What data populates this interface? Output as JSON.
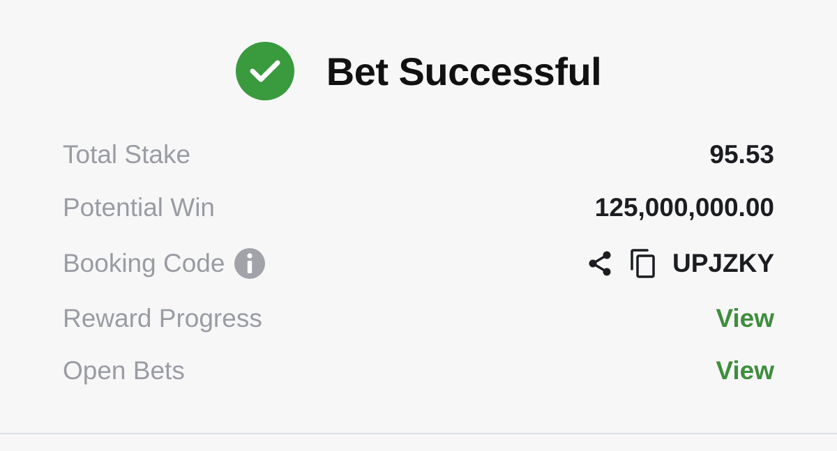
{
  "header": {
    "title": "Bet Successful",
    "status_color": "#3a9a3e",
    "icon": "check-circle-icon"
  },
  "rows": {
    "total_stake": {
      "label": "Total Stake",
      "value": "95.53"
    },
    "potential_win": {
      "label": "Potential Win",
      "value": "125,000,000.00"
    },
    "booking_code": {
      "label": "Booking Code",
      "value": "UPJZKY",
      "icons": [
        "info-icon",
        "share-icon",
        "copy-icon"
      ]
    },
    "reward_progress": {
      "label": "Reward Progress",
      "action": "View"
    },
    "open_bets": {
      "label": "Open Bets",
      "action": "View"
    }
  },
  "colors": {
    "link": "#3e8e3c",
    "label": "#9a9ca3",
    "value": "#1c1d21"
  }
}
